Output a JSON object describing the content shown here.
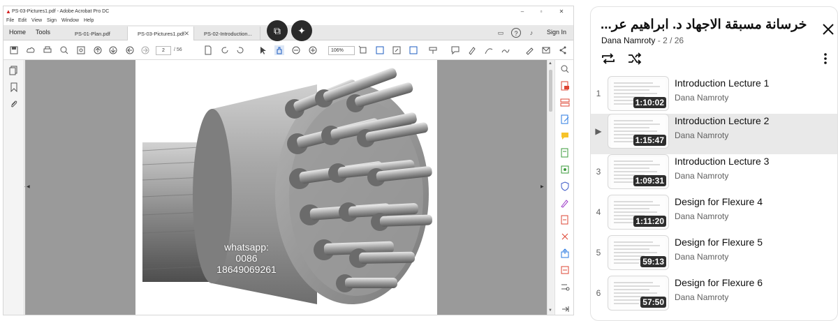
{
  "acrobat": {
    "window_title": "PS-03-Pictures1.pdf - Adobe Acrobat Pro DC",
    "menu": [
      "File",
      "Edit",
      "View",
      "Sign",
      "Window",
      "Help"
    ],
    "nav": {
      "home": "Home",
      "tools": "Tools"
    },
    "tabs": [
      {
        "label": "PS-01-Plan.pdf"
      },
      {
        "label": "PS-03-Pictures1.pdf"
      },
      {
        "label": "PS-02-Introduction..."
      }
    ],
    "sign_in": "Sign In",
    "page_current": "2",
    "page_total": "/ 56",
    "zoom": "106%",
    "watermark": {
      "line1": "whatsapp:",
      "line2": "0086",
      "line3": "18649069261"
    }
  },
  "playlist": {
    "title": "خرسانة مسبقة الاجهاد د. ابراهيم عر...",
    "owner": "Dana Namroty",
    "position": "2 / 26",
    "items": [
      {
        "index": "1",
        "title": "Introduction Lecture 1",
        "channel": "Dana Namroty",
        "duration": "1:10:02",
        "current": false
      },
      {
        "index": "▶",
        "title": "Introduction Lecture 2",
        "channel": "Dana Namroty",
        "duration": "1:15:47",
        "current": true
      },
      {
        "index": "3",
        "title": "Introduction Lecture 3",
        "channel": "Dana Namroty",
        "duration": "1:09:31",
        "current": false
      },
      {
        "index": "4",
        "title": "Design for Flexure 4",
        "channel": "Dana Namroty",
        "duration": "1:11:20",
        "current": false
      },
      {
        "index": "5",
        "title": "Design for Flexure 5",
        "channel": "Dana Namroty",
        "duration": "59:13",
        "current": false
      },
      {
        "index": "6",
        "title": "Design for Flexure 6",
        "channel": "Dana Namroty",
        "duration": "57:50",
        "current": false
      }
    ]
  }
}
